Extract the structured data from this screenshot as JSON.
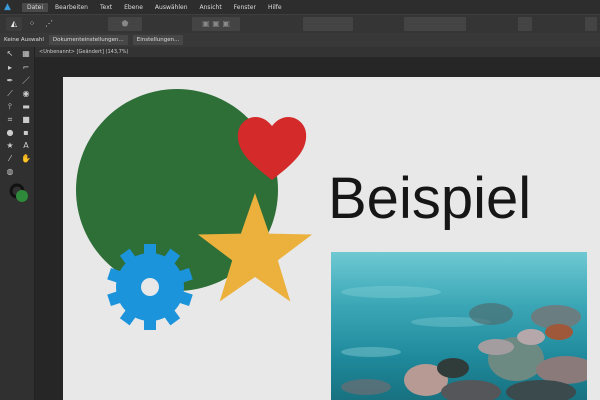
{
  "app": {
    "logo": "affinity-logo-icon"
  },
  "menu": [
    "Datei",
    "Bearbeiten",
    "Text",
    "Ebene",
    "Auswählen",
    "Ansicht",
    "Fenster",
    "Hilfe"
  ],
  "context": {
    "selection": "Keine Auswahl",
    "doc_settings": "Dokumenteinstellungen...",
    "settings": "Einstellungen..."
  },
  "document": {
    "tab": "<Unbenannt> [Geändert] (143,7%)"
  },
  "canvas": {
    "text": "Beispiel"
  },
  "colors": {
    "circle": "#2e6e37",
    "heart": "#d42a2a",
    "star": "#ebb13c",
    "gear": "#1b94dc",
    "accent": "#3a9bdc"
  }
}
